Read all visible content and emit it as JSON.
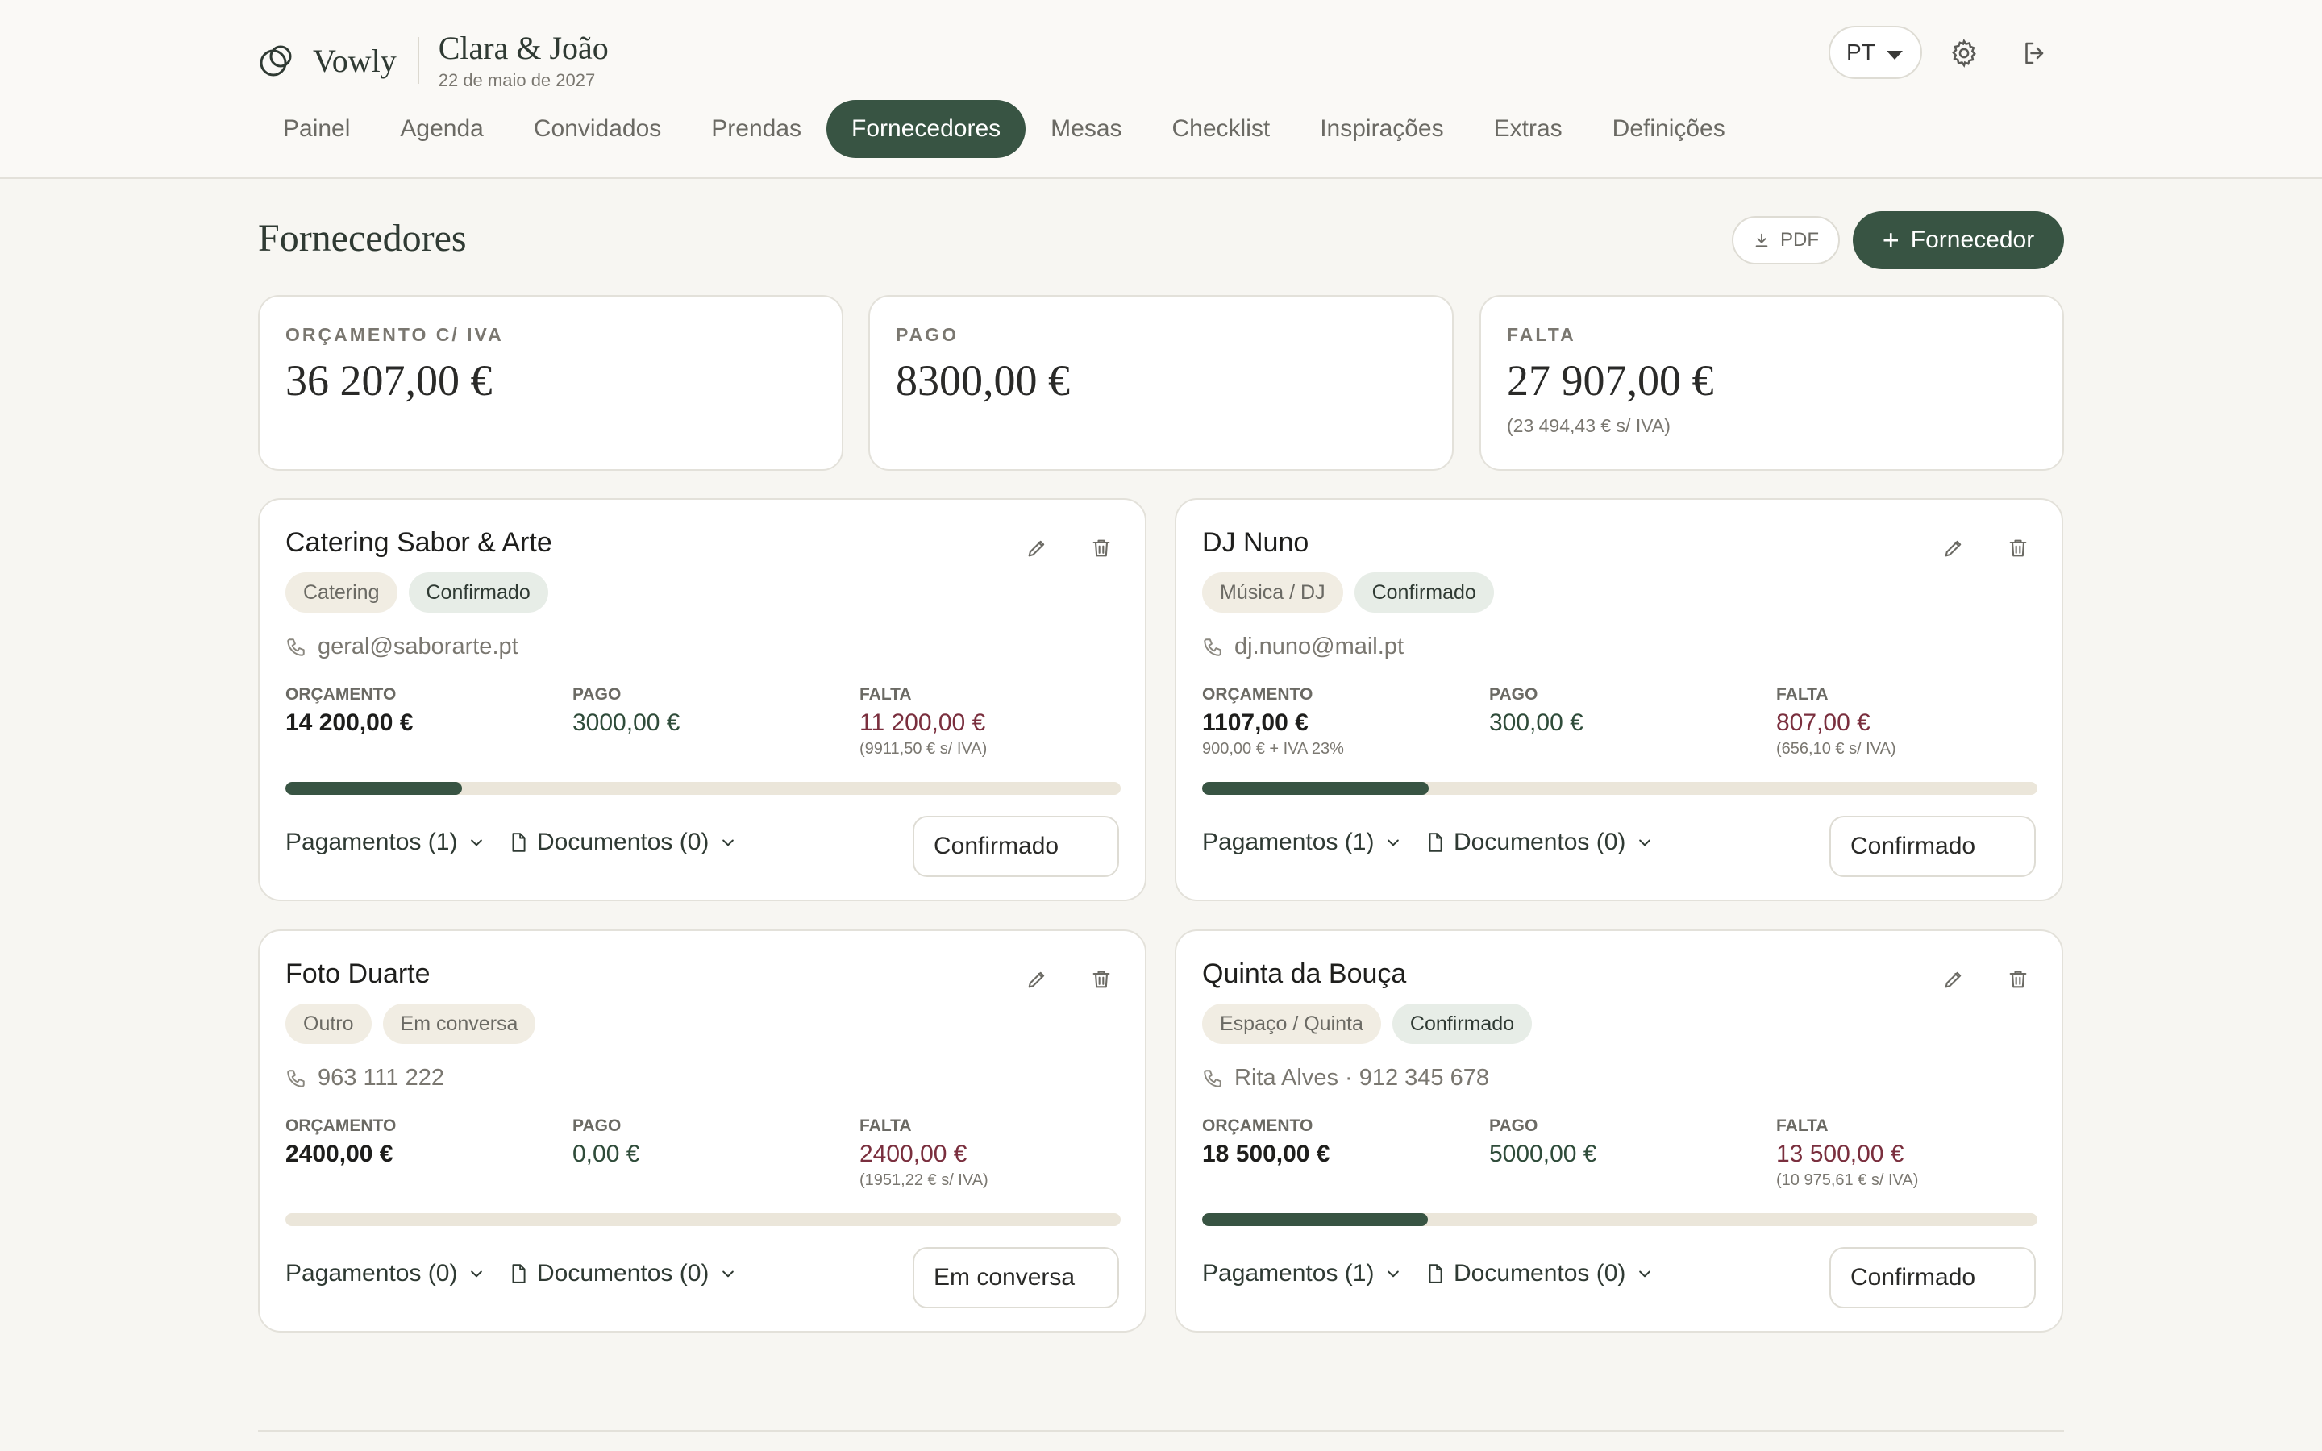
{
  "brand": {
    "name": "Vowly",
    "couple": "Clara & João",
    "date": "22 de maio de 2027"
  },
  "header": {
    "lang": "PT"
  },
  "nav": [
    "Painel",
    "Agenda",
    "Convidados",
    "Prendas",
    "Fornecedores",
    "Mesas",
    "Checklist",
    "Inspirações",
    "Extras",
    "Definições"
  ],
  "nav_active": "Fornecedores",
  "page": {
    "title": "Fornecedores",
    "pdf_label": "PDF",
    "add_label": "Fornecedor"
  },
  "summary": {
    "budget": {
      "label": "ORÇAMENTO C/ IVA",
      "value": "36 207,00 €"
    },
    "paid": {
      "label": "PAGO",
      "value": "8300,00 €"
    },
    "missing": {
      "label": "FALTA",
      "value": "27 907,00 €",
      "note": "(23 494,43 € s/ IVA)"
    }
  },
  "vendor_labels": {
    "budget": "ORÇAMENTO",
    "paid": "PAGO",
    "missing": "FALTA"
  },
  "vendors": [
    {
      "name": "Catering Sabor & Arte",
      "category": "Catering",
      "status": "Confirmado",
      "contact": "geral@saborarte.pt",
      "budget": "14 200,00 €",
      "budget_note": "",
      "paid": "3000,00 €",
      "missing": "11 200,00 €",
      "missing_note": "(9911,50 € s/ IVA)",
      "progress": 0.211,
      "payments": "Pagamentos (1)",
      "documents": "Documentos (0)",
      "select": "Confirmado"
    },
    {
      "name": "DJ Nuno",
      "category": "Música / DJ",
      "status": "Confirmado",
      "contact": "dj.nuno@mail.pt",
      "budget": "1107,00 €",
      "budget_note": "900,00 € + IVA 23%",
      "paid": "300,00 €",
      "missing": "807,00 €",
      "missing_note": "(656,10 € s/ IVA)",
      "progress": 0.271,
      "payments": "Pagamentos (1)",
      "documents": "Documentos (0)",
      "select": "Confirmado"
    },
    {
      "name": "Foto Duarte",
      "category": "Outro",
      "status": "Em conversa",
      "contact": "963 111 222",
      "budget": "2400,00 €",
      "budget_note": "",
      "paid": "0,00 €",
      "missing": "2400,00 €",
      "missing_note": "(1951,22 € s/ IVA)",
      "progress": 0,
      "payments": "Pagamentos (0)",
      "documents": "Documentos (0)",
      "select": "Em conversa"
    },
    {
      "name": "Quinta da Bouça",
      "category": "Espaço / Quinta",
      "status": "Confirmado",
      "contact": "Rita Alves · 912 345 678",
      "budget": "18 500,00 €",
      "budget_note": "",
      "paid": "5000,00 €",
      "missing": "13 500,00 €",
      "missing_note": "(10 975,61 € s/ IVA)",
      "progress": 0.27,
      "payments": "Pagamentos (1)",
      "documents": "Documentos (0)",
      "select": "Confirmado"
    }
  ],
  "colors": {
    "accent": "#385443",
    "missing": "#7a2f3e",
    "background": "#f7f6f2"
  }
}
